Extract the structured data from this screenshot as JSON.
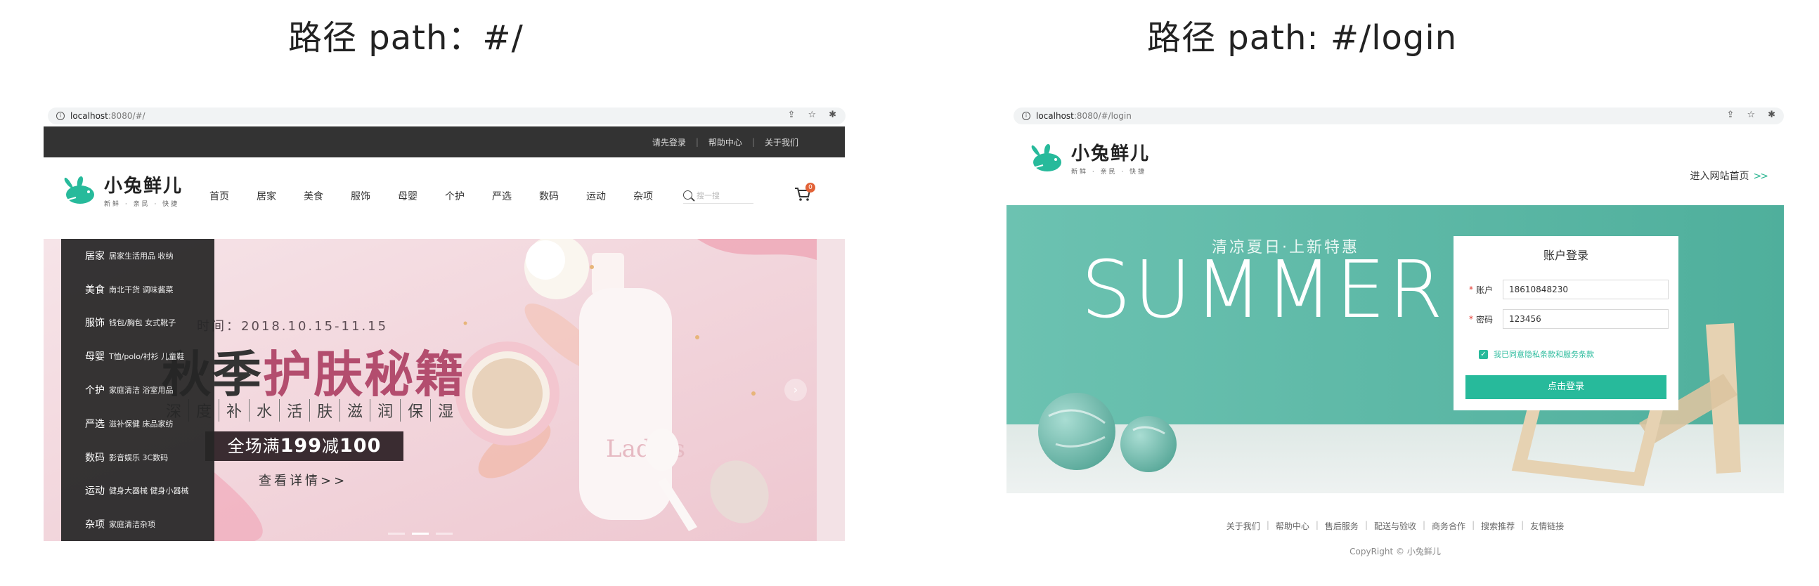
{
  "headings": {
    "left": "路径 path：#/",
    "right": "路径 path: #/login"
  },
  "brand": {
    "title": "小兔鲜儿",
    "tagline": "新鲜 · 亲民 · 快捷"
  },
  "home": {
    "url_host": "localhost",
    "url_rest": ":8080/#/",
    "topnav": [
      "请先登录",
      "帮助中心",
      "关于我们"
    ],
    "mainnav": [
      "首页",
      "居家",
      "美食",
      "服饰",
      "母婴",
      "个护",
      "严选",
      "数码",
      "运动",
      "杂项"
    ],
    "search_placeholder": "搜一搜",
    "cart_count": "0",
    "categories": [
      {
        "name": "居家",
        "subs": "居家生活用品 收纳"
      },
      {
        "name": "美食",
        "subs": "南北干货 调味酱菜"
      },
      {
        "name": "服饰",
        "subs": "钱包/胸包 女式靴子"
      },
      {
        "name": "母婴",
        "subs": "T恤/polo/衬衫 儿童鞋"
      },
      {
        "name": "个护",
        "subs": "家庭清洁 浴室用品"
      },
      {
        "name": "严选",
        "subs": "滋补保健 床品家纺"
      },
      {
        "name": "数码",
        "subs": "影音娱乐 3C数码"
      },
      {
        "name": "运动",
        "subs": "健身大器械 健身小器械"
      },
      {
        "name": "杂项",
        "subs": "家庭清洁杂项"
      }
    ],
    "banner": {
      "date": "时间：2018.10.15-11.15",
      "title_a": "秋季",
      "title_b": "护肤秘籍",
      "words": [
        "深",
        "度",
        "补",
        "水",
        "活",
        "肤",
        "滋",
        "润",
        "保",
        "湿"
      ],
      "offer_prefix": "全场满",
      "offer_a": "199",
      "offer_mid": "减",
      "offer_b": "100",
      "more": "查看详情>>",
      "bottle_text": "Ladies"
    }
  },
  "login": {
    "url_host": "localhost",
    "url_rest": ":8080/#/login",
    "enter_link": "进入网站首页",
    "summer_sub": "清凉夏日·上新特惠",
    "summer_big": "SUMMER",
    "card_title": "账户登录",
    "account_label": "账户",
    "account_value": "18610848230",
    "password_label": "密码",
    "password_value": "123456",
    "agree_text": "我已同意隐私条款和服务条款",
    "submit_label": "点击登录",
    "footer_links": [
      "关于我们",
      "帮助中心",
      "售后服务",
      "配送与验收",
      "商务合作",
      "搜索推荐",
      "友情链接"
    ],
    "copyright": "CopyRight © 小兔鲜儿"
  },
  "colors": {
    "brand_green": "#27ba9b",
    "topbar": "#333333",
    "teal_bg": "#5fb9a8",
    "badge": "#e26237"
  }
}
